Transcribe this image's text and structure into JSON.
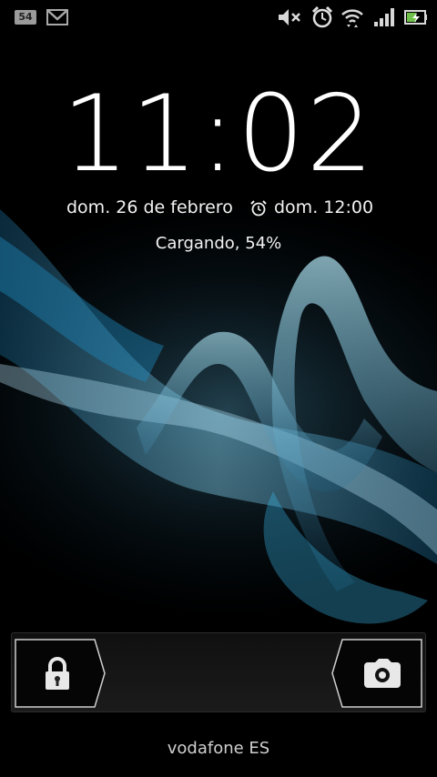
{
  "status_bar": {
    "notification_count": "54",
    "icons": [
      "notification-badge-icon",
      "gmail-icon",
      "mute-icon",
      "alarm-clock-icon",
      "wifi-icon",
      "signal-icon",
      "battery-charging-icon"
    ]
  },
  "lockscreen": {
    "time": "11:02",
    "date": "dom. 26 de febrero",
    "alarm": "dom. 12:00",
    "charging_status": "Cargando, 54%",
    "battery_level_percent": 54
  },
  "slider": {
    "left_icon": "lock-icon",
    "right_icon": "camera-icon"
  },
  "carrier": "vodafone ES",
  "colors": {
    "background": "#000000",
    "wave_accent": "#3ab4e6",
    "text": "#ffffff"
  }
}
